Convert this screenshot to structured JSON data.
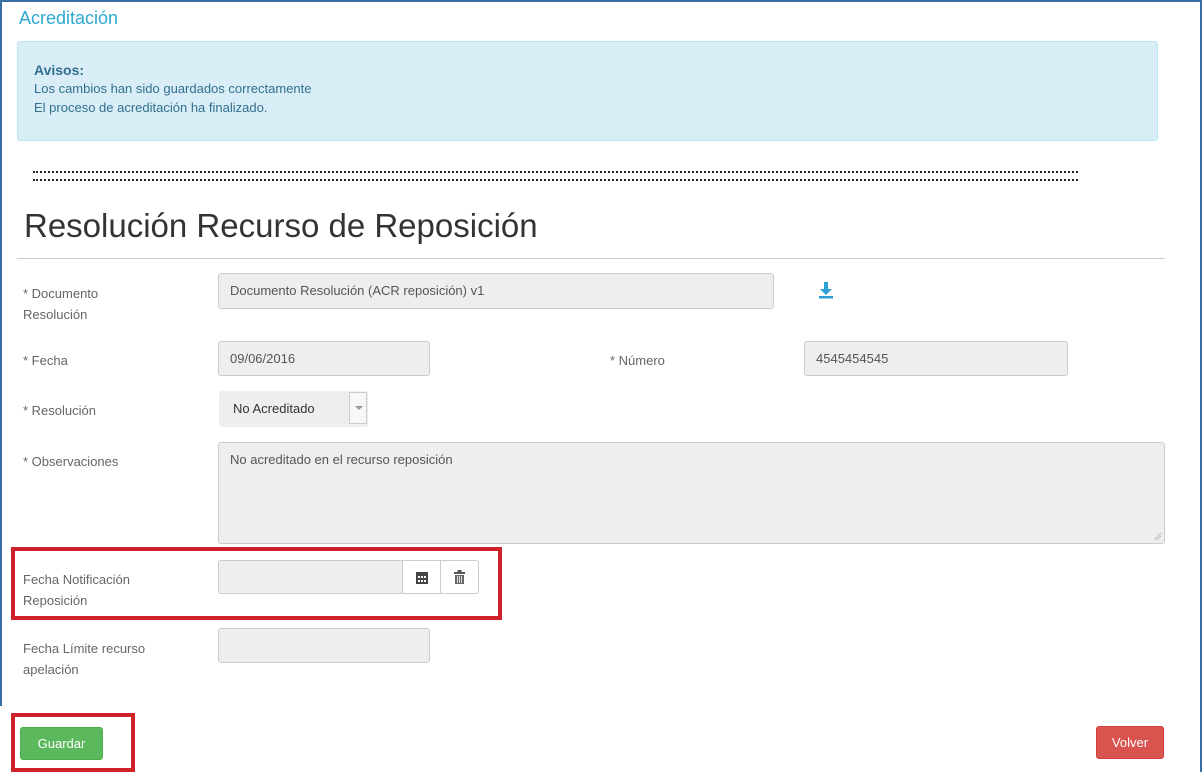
{
  "header": {
    "title": "Acreditación"
  },
  "alert": {
    "title": "Avisos:",
    "lines": [
      "Los cambios han sido guardados correctamente",
      "El proceso de acreditación ha finalizado."
    ]
  },
  "section": {
    "title": "Resolución Recurso de Reposición"
  },
  "form": {
    "documento": {
      "label_line1": "* Documento",
      "label_line2": "Resolución",
      "value": "Documento Resolución (ACR reposición) v1",
      "icon": "download-icon"
    },
    "fecha": {
      "label": "* Fecha",
      "value": "09/06/2016"
    },
    "numero": {
      "label": "* Número",
      "value": "4545454545"
    },
    "resolucion": {
      "label": "* Resolución",
      "selected": "No Acreditado"
    },
    "observaciones": {
      "label": "* Observaciones",
      "value": "No acreditado en el recurso reposición"
    },
    "fecha_notificacion": {
      "label_line1": "Fecha Notificación",
      "label_line2": "Reposición",
      "value": "",
      "icons": [
        "calendar-icon",
        "trash-icon"
      ]
    },
    "fecha_limite": {
      "label_line1": "Fecha Límite recurso",
      "label_line2": "apelación",
      "value": ""
    }
  },
  "buttons": {
    "save": "Guardar",
    "back": "Volver"
  },
  "colors": {
    "accent": "#2ea8d0",
    "alert_bg": "#d9edf7",
    "highlight": "#d0202a",
    "save": "#5cb85c",
    "back": "#d9534f"
  }
}
